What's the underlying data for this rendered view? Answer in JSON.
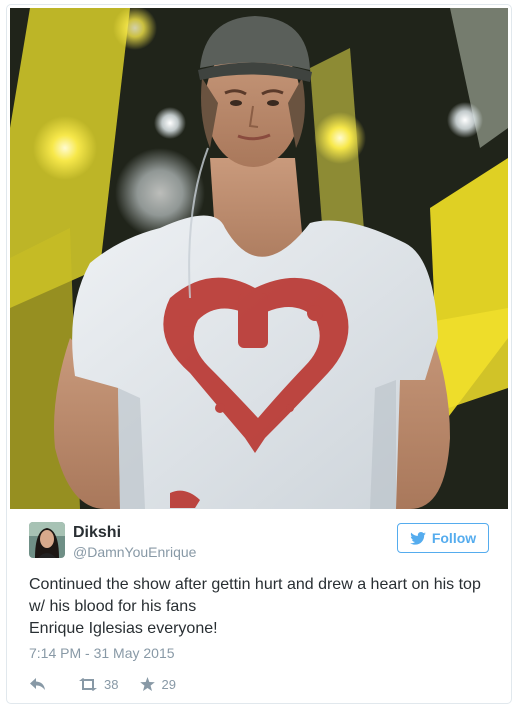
{
  "user": {
    "name": "Dikshi",
    "handle": "@DamnYouEnrique"
  },
  "follow": {
    "label": "Follow"
  },
  "tweet": {
    "lines": [
      "Continued the show after gettin hurt and drew a heart on his top",
      "w/ his blood for his fans",
      "Enrique Iglesias everyone!"
    ],
    "timestamp": "7:14 PM - 31 May 2015"
  },
  "actions": {
    "retweet_count": "38",
    "favorite_count": "29"
  },
  "colors": {
    "accent": "#55acee",
    "muted": "#8899a6",
    "text": "#292f33"
  },
  "icons": [
    "twitter-bird-icon",
    "reply-icon",
    "retweet-icon",
    "star-icon"
  ]
}
